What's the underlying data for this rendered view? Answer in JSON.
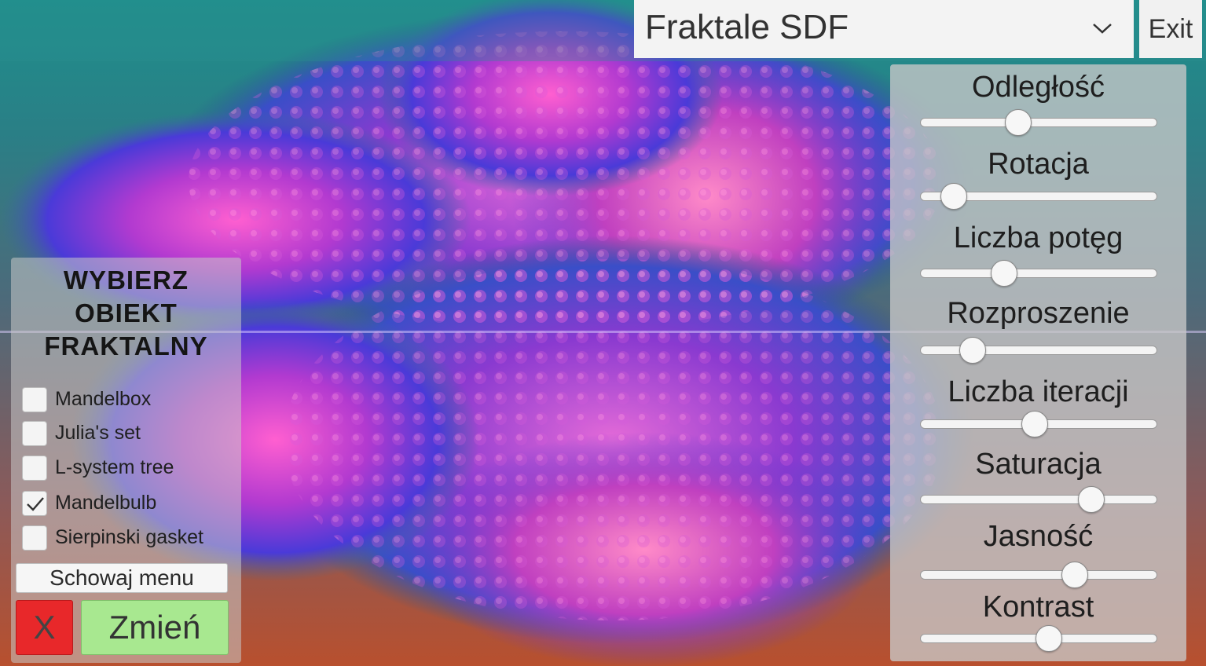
{
  "dropdown": {
    "selected": "Fraktale SDF",
    "icon": "chevron-down-icon"
  },
  "exit_label": "Exit",
  "sliders": [
    {
      "label": "Odległość",
      "value": 0.41
    },
    {
      "label": "Rotacja",
      "value": 0.14
    },
    {
      "label": "Liczba potęg",
      "value": 0.35
    },
    {
      "label": "Rozproszenie",
      "value": 0.22
    },
    {
      "label": "Liczba iteracji",
      "value": 0.48
    },
    {
      "label": "Saturacja",
      "value": 0.72
    },
    {
      "label": "Jasność",
      "value": 0.65
    },
    {
      "label": "Kontrast",
      "value": 0.54
    }
  ],
  "left_panel": {
    "title": "WYBIERZ OBIEKT FRAKTALNY",
    "options": [
      {
        "label": "Mandelbox",
        "checked": false
      },
      {
        "label": "Julia's set",
        "checked": false
      },
      {
        "label": "L-system tree",
        "checked": false
      },
      {
        "label": "Mandelbulb",
        "checked": true
      },
      {
        "label": "Sierpinski gasket",
        "checked": false
      }
    ],
    "hide_menu_label": "Schowaj menu",
    "cancel_label": "X",
    "change_label": "Zmień"
  },
  "colors": {
    "cancel_button": "#e8282a",
    "change_button": "#a8e890",
    "fractal_primary": "#b63cc8",
    "fractal_secondary": "#3c4fd8"
  }
}
